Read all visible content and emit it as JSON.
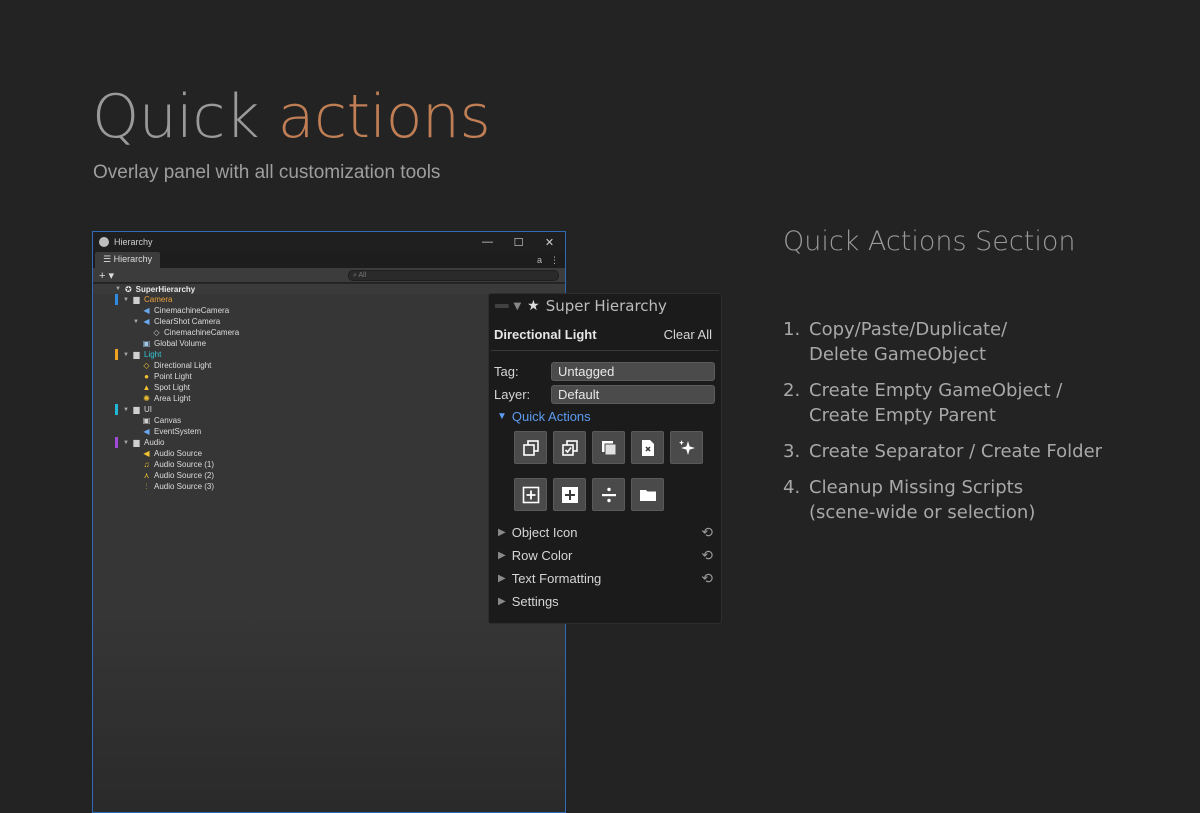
{
  "hero": {
    "word1": "Quick",
    "word2": "actions",
    "subtitle": "Overlay panel with all customization tools"
  },
  "window": {
    "title": "Hierarchy",
    "controls": [
      "—",
      "☐",
      "✕"
    ],
    "tab": "Hierarchy",
    "tab_icons": [
      "a",
      "⋮"
    ],
    "add_label": "+ ▾",
    "search_placeholder": "All",
    "scene": "SuperHierarchy",
    "tree": [
      {
        "name": "Camera",
        "depth": 1,
        "arrow": "▼",
        "glyph": "▆",
        "color": "#e8a03a",
        "bar": "#2f8be0",
        "glyph_color": "#cfcfcf"
      },
      {
        "name": "CinemachineCamera",
        "depth": 2,
        "arrow": "",
        "glyph": "◀",
        "color": "#dcdcdc",
        "bar": "",
        "glyph_color": "#6aa8f0"
      },
      {
        "name": "ClearShot Camera",
        "depth": 2,
        "arrow": "▼",
        "glyph": "◀",
        "color": "#dcdcdc",
        "bar": "",
        "glyph_color": "#6aa8f0"
      },
      {
        "name": "CinemachineCamera",
        "depth": 3,
        "arrow": "",
        "glyph": "◇",
        "color": "#dcdcdc",
        "bar": "",
        "glyph_color": "#cfcfcf"
      },
      {
        "name": "Global Volume",
        "depth": 2,
        "arrow": "",
        "glyph": "▣",
        "color": "#dcdcdc",
        "bar": "",
        "glyph_color": "#9fc6e6"
      },
      {
        "name": "Light",
        "depth": 1,
        "arrow": "▼",
        "glyph": "▆",
        "color": "#33c5d6",
        "bar": "#f0a020",
        "glyph_color": "#cfcfcf"
      },
      {
        "name": "Directional Light",
        "depth": 2,
        "arrow": "",
        "glyph": "◇",
        "color": "#dcdcdc",
        "bar": "",
        "glyph_color": "#f2c230"
      },
      {
        "name": "Point Light",
        "depth": 2,
        "arrow": "",
        "glyph": "●",
        "color": "#dcdcdc",
        "bar": "",
        "glyph_color": "#f2c230"
      },
      {
        "name": "Spot Light",
        "depth": 2,
        "arrow": "",
        "glyph": "▲",
        "color": "#dcdcdc",
        "bar": "",
        "glyph_color": "#f2c230"
      },
      {
        "name": "Area Light",
        "depth": 2,
        "arrow": "",
        "glyph": "✺",
        "color": "#dcdcdc",
        "bar": "",
        "glyph_color": "#f2c230"
      },
      {
        "name": "UI",
        "depth": 1,
        "arrow": "▼",
        "glyph": "▆",
        "color": "#dcdcdc",
        "bar": "#22b7d6",
        "glyph_color": "#cfcfcf"
      },
      {
        "name": "Canvas",
        "depth": 2,
        "arrow": "",
        "glyph": "▣",
        "color": "#dcdcdc",
        "bar": "",
        "glyph_color": "#cfcfcf"
      },
      {
        "name": "EventSystem",
        "depth": 2,
        "arrow": "",
        "glyph": "◀",
        "color": "#dcdcdc",
        "bar": "",
        "glyph_color": "#6aa8f0"
      },
      {
        "name": "Audio",
        "depth": 1,
        "arrow": "▼",
        "glyph": "▆",
        "color": "#dcdcdc",
        "bar": "#a24ad8",
        "glyph_color": "#cfcfcf"
      },
      {
        "name": "Audio Source",
        "depth": 2,
        "arrow": "",
        "glyph": "◀",
        "color": "#dcdcdc",
        "bar": "",
        "glyph_color": "#f2c230"
      },
      {
        "name": "Audio Source (1)",
        "depth": 2,
        "arrow": "",
        "glyph": "♫",
        "color": "#dcdcdc",
        "bar": "",
        "glyph_color": "#f2c230"
      },
      {
        "name": "Audio Source (2)",
        "depth": 2,
        "arrow": "",
        "glyph": "⋏",
        "color": "#dcdcdc",
        "bar": "",
        "glyph_color": "#f2c230"
      },
      {
        "name": "Audio Source (3)",
        "depth": 2,
        "arrow": "",
        "glyph": "⫶",
        "color": "#dcdcdc",
        "bar": "",
        "glyph_color": "#f2c230"
      }
    ]
  },
  "panel": {
    "title": "Super Hierarchy",
    "object_name": "Directional Light",
    "clear_all": "Clear All",
    "tag_label": "Tag:",
    "tag_value": "Untagged",
    "layer_label": "Layer:",
    "layer_value": "Default",
    "quick_actions": "Quick Actions",
    "buttons_row1": [
      "copy-icon",
      "paste-icon",
      "duplicate-icon",
      "delete-icon",
      "cleanup-sparkle-icon"
    ],
    "buttons_row2": [
      "create-empty-icon",
      "create-parent-icon",
      "separator-icon",
      "folder-icon"
    ],
    "sections": [
      "Object Icon",
      "Row Color",
      "Text Formatting",
      "Settings"
    ],
    "reset_glyph": "⟲"
  },
  "right": {
    "title": "Quick Actions Section",
    "items": [
      {
        "num": "1.",
        "text": "Copy/Paste/Duplicate/\nDelete GameObject"
      },
      {
        "num": "2.",
        "text": "Create Empty GameObject /\nCreate Empty Parent"
      },
      {
        "num": "3.",
        "text": "Create Separator / Create Folder"
      },
      {
        "num": "4.",
        "text": "Cleanup Missing Scripts\n(scene-wide or selection)"
      }
    ]
  },
  "colors": {
    "accent": "#c07e55",
    "blue": "#5c9bf0",
    "window_border": "#2f6bb5"
  }
}
